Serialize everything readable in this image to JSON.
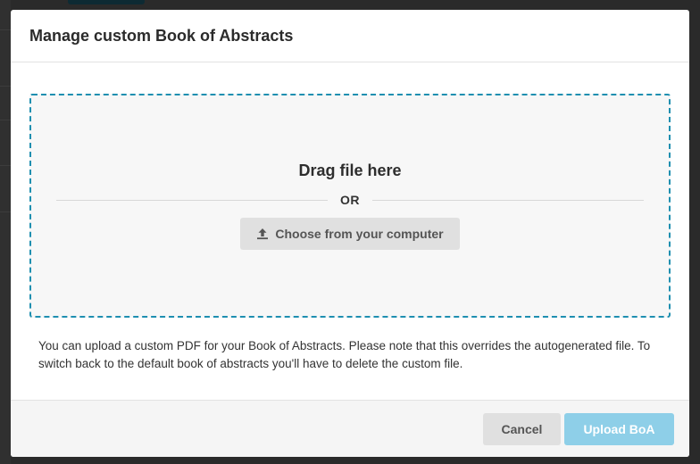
{
  "modal": {
    "title": "Manage custom Book of Abstracts"
  },
  "dropzone": {
    "drag_text": "Drag file here",
    "or_text": "OR",
    "choose_button_label": "Choose from your computer",
    "choose_button_icon": "upload-icon"
  },
  "help_text": "You can upload a custom PDF for your Book of Abstracts. Please note that this overrides the autogenerated file. To switch back to the default book of abstracts you'll have to delete the custom file.",
  "footer": {
    "cancel_label": "Cancel",
    "upload_label": "Upload BoA",
    "upload_disabled": true
  },
  "colors": {
    "dropzone_border": "#1e8fb0",
    "primary_disabled": "#8ecfe8",
    "secondary_button": "#e0e0e0"
  }
}
